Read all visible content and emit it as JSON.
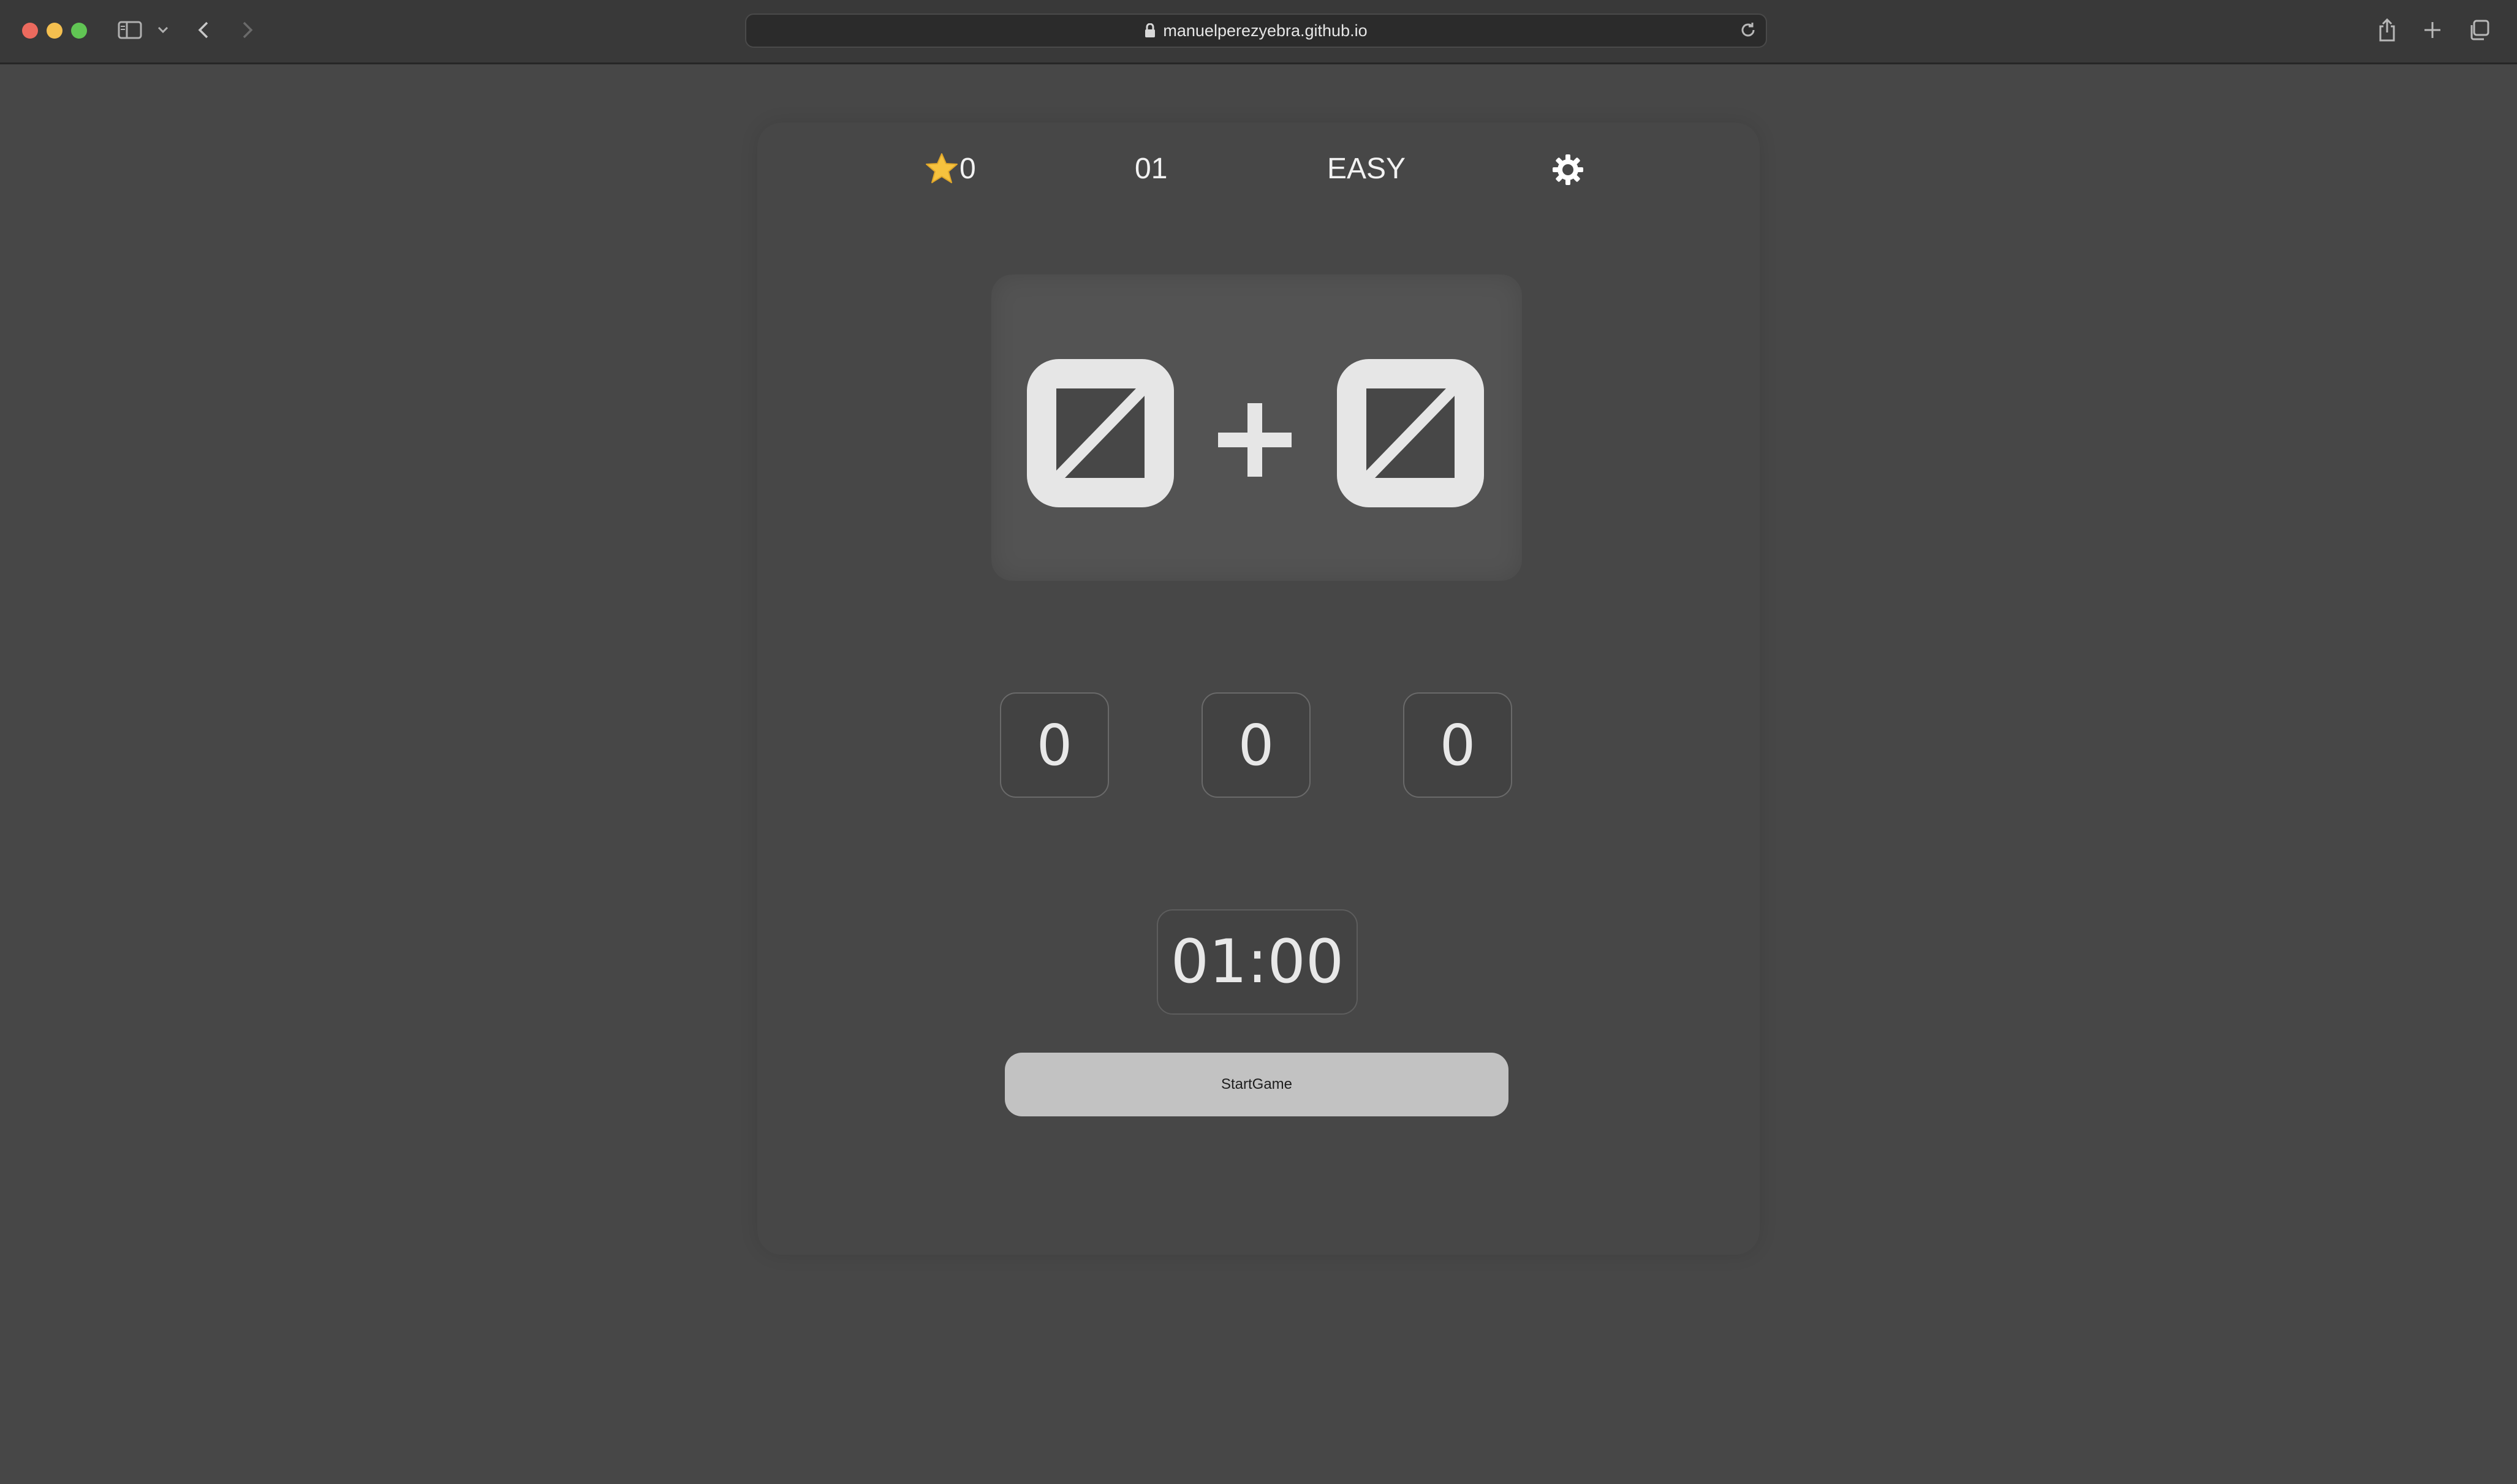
{
  "browser": {
    "url": "manuelperezyebra.github.io"
  },
  "hud": {
    "stars": "0",
    "round": "01",
    "difficulty": "EASY"
  },
  "equation": {
    "operator": "+"
  },
  "answers": [
    "0",
    "0",
    "0"
  ],
  "timer": "01:00",
  "start_button": "StartGame",
  "icons": {
    "star": "star-icon",
    "settings": "gear-icon",
    "lock": "lock-icon"
  },
  "colors": {
    "background": "#474747",
    "tile": "#e6e6e6",
    "star": "#f6c23e",
    "button": "#c2c2c2"
  }
}
